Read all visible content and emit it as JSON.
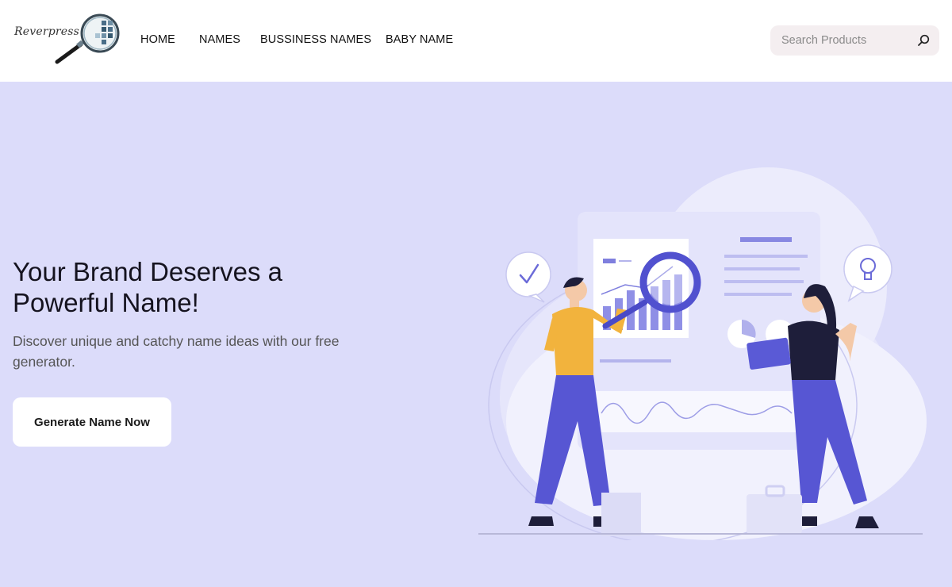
{
  "header": {
    "logo_text": "Reverpress",
    "nav": [
      {
        "label": "HOME"
      },
      {
        "label": "NAMES"
      },
      {
        "label": "BUSSINESS NAMES"
      },
      {
        "label": "BABY NAME"
      }
    ],
    "search": {
      "placeholder": "Search Products",
      "icon": "search-icon"
    }
  },
  "hero": {
    "title": "Your Brand Deserves a Powerful Name!",
    "subtitle": "Discover unique and catchy name ideas with our free generator.",
    "cta_label": "Generate Name Now",
    "background": "#dcdcfa",
    "accent": "#5b5bd6"
  }
}
